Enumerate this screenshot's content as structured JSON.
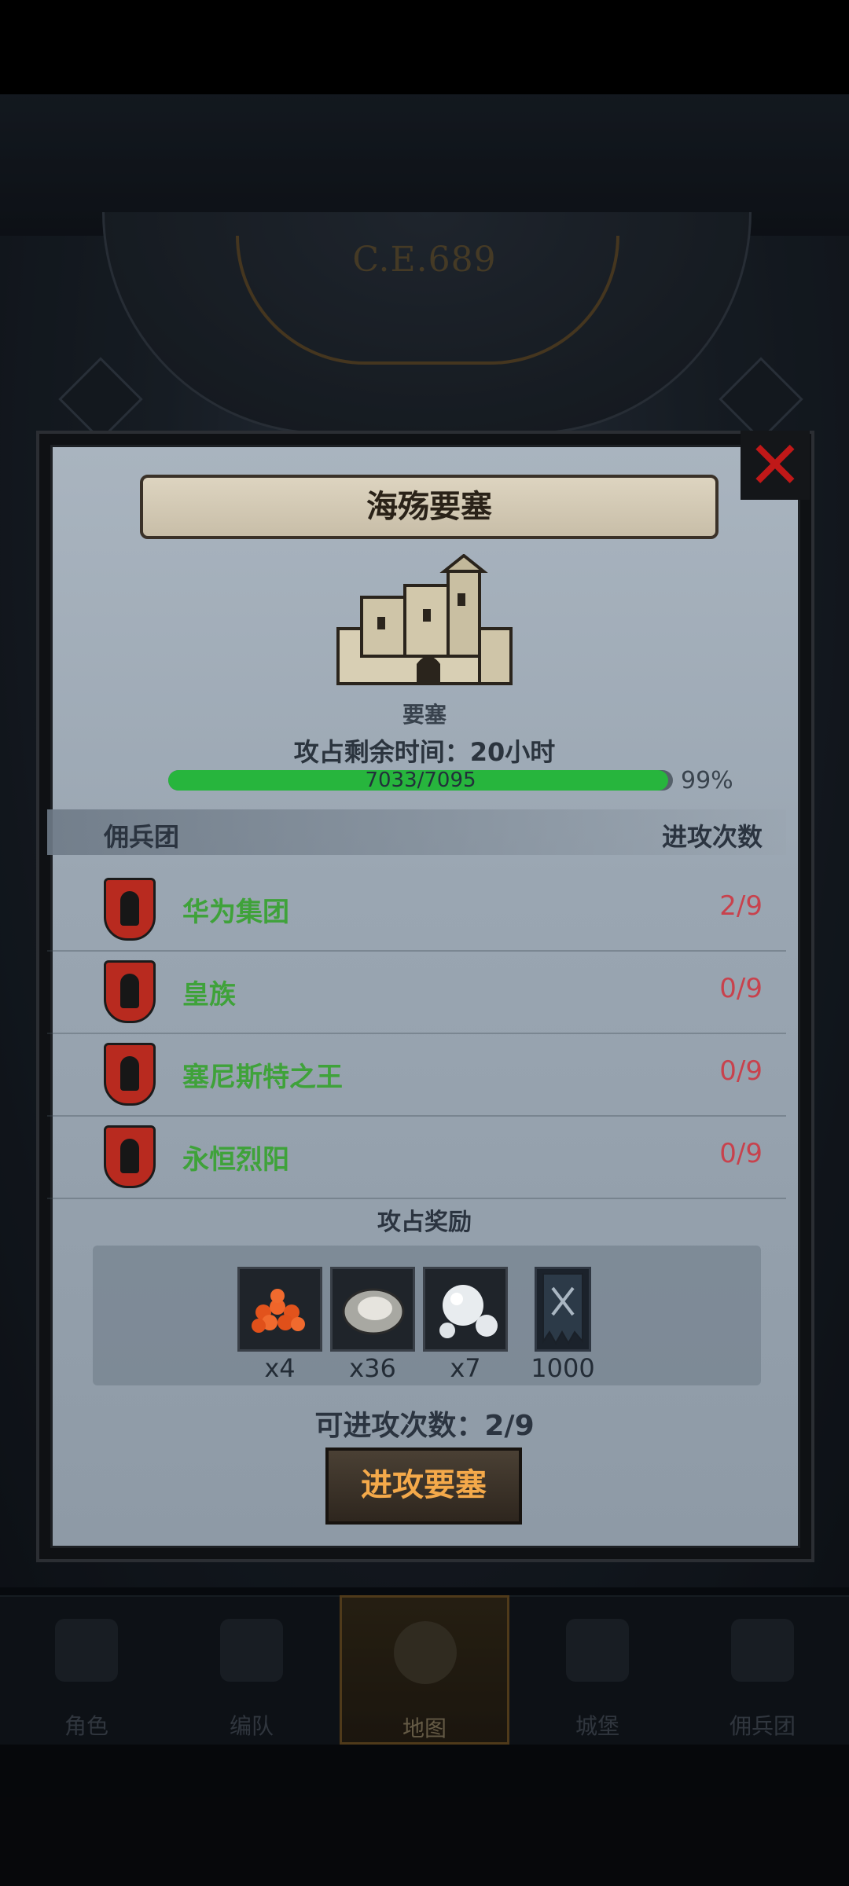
{
  "background": {
    "year": "C.E.689"
  },
  "modal": {
    "title": "海殇要塞",
    "fortress_label": "要塞",
    "remaining_time": "攻占剩余时间：20小时",
    "progress_text": "7033/7095",
    "progress_value": 0.99,
    "progress_percent": "99%",
    "list_header_left": "佣兵团",
    "list_header_right": "进攻次数",
    "mercenaries": [
      {
        "name": "华为集团",
        "attacks": "2/9"
      },
      {
        "name": "皇族",
        "attacks": "0/9"
      },
      {
        "name": "塞尼斯特之王",
        "attacks": "0/9"
      },
      {
        "name": "永恒烈阳",
        "attacks": "0/9"
      }
    ],
    "rewards_title": "攻占奖励",
    "rewards": [
      {
        "icon": "roe-icon",
        "qty": "x4"
      },
      {
        "icon": "oyster-icon",
        "qty": "x36"
      },
      {
        "icon": "pearl-icon",
        "qty": "x7"
      },
      {
        "icon": "banner-icon",
        "qty": "1000"
      }
    ],
    "available_attacks": "可进攻次数：2/9",
    "attack_button": "进攻要塞",
    "close_icon": "close-icon"
  },
  "nav": {
    "items": [
      {
        "label": "角色",
        "icon": "knight-icon"
      },
      {
        "label": "编队",
        "icon": "helmet-icon"
      },
      {
        "label": "地图",
        "icon": "compass-icon",
        "active": true
      },
      {
        "label": "城堡",
        "icon": "castle-icon"
      },
      {
        "label": "佣兵团",
        "icon": "ship-icon"
      }
    ]
  },
  "colors": {
    "progress_fill": "#27b53d",
    "mercenary_name": "#3fa23a",
    "attack_count": "#c8424d",
    "attack_button_text": "#f4a94a",
    "close_x": "#c01818"
  }
}
